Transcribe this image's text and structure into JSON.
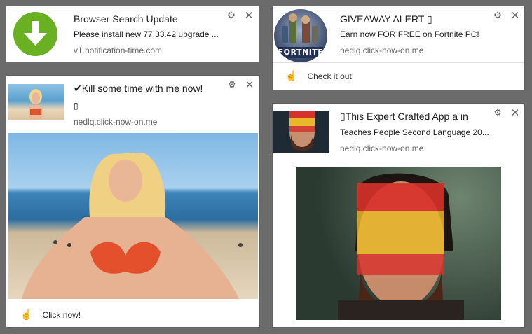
{
  "notifications": [
    {
      "title": "Browser Search Update",
      "body": "Please install new 77.33.42 upgrade ...",
      "domain": "v1.notification-time.com",
      "icon": "download-arrow-icon"
    },
    {
      "title": "GIVEAWAY ALERT ▯",
      "body": "Earn now FOR FREE on Fortnite PC!",
      "domain": "nedlq.click-now-on.me",
      "action": "Check it out!",
      "thumb_text": "FORTNITE"
    },
    {
      "title": "✔Kill some time with me now!",
      "body": "▯",
      "domain": "nedlq.click-now-on.me",
      "action": "Click now!"
    },
    {
      "title": "▯This Expert Crafted App a in",
      "body": "Teaches People Second Language 20...",
      "domain": "nedlq.click-now-on.me"
    }
  ],
  "icons": {
    "gear": "⚙",
    "close": "✕",
    "hand": "☝"
  },
  "colors": {
    "download_green": "#6ab023",
    "background": "#6b6b6b"
  }
}
